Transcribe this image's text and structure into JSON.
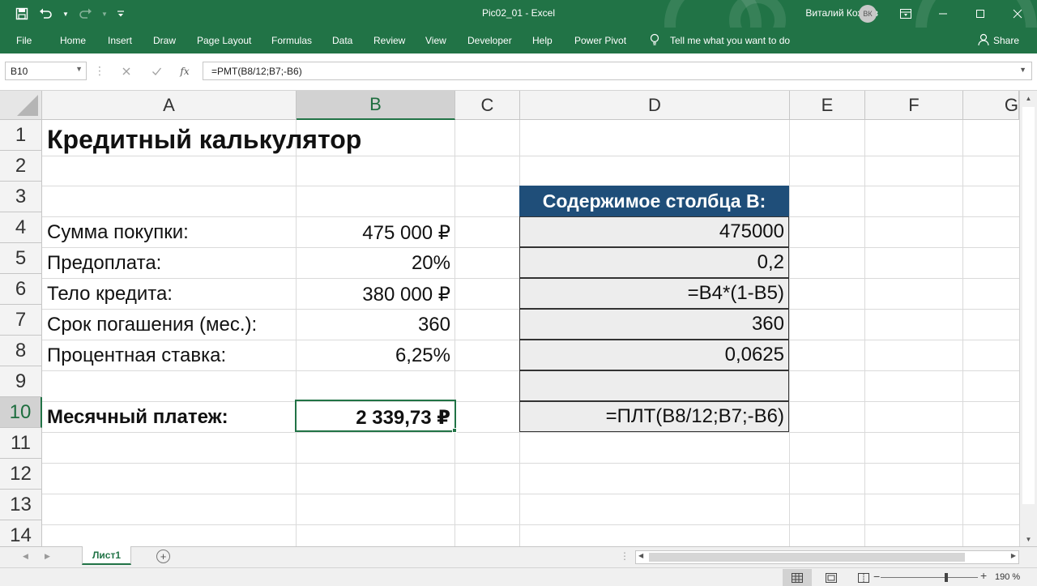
{
  "window": {
    "title": "Pic02_01  -  Excel",
    "user_name": "Виталий Козлов",
    "user_initials": "ВК"
  },
  "ribbon": {
    "tabs": [
      "File",
      "Home",
      "Insert",
      "Draw",
      "Page Layout",
      "Formulas",
      "Data",
      "Review",
      "View",
      "Developer",
      "Help",
      "Power Pivot"
    ],
    "tell_me": "Tell me what you want to do",
    "share": "Share"
  },
  "formula_bar": {
    "name_box": "B10",
    "fx": "fx",
    "formula": "=PMT(B8/12;B7;-B6)"
  },
  "grid": {
    "columns": [
      "A",
      "B",
      "C",
      "D",
      "E",
      "F",
      "G"
    ],
    "selected_column": "B",
    "rows": [
      "1",
      "2",
      "3",
      "4",
      "5",
      "6",
      "7",
      "8",
      "9",
      "10",
      "11",
      "12",
      "13",
      "14"
    ],
    "selected_row": "10",
    "title": "Кредитный калькулятор",
    "labels": {
      "r4": "Сумма покупки:",
      "r5": "Предоплата:",
      "r6": "Тело кредита:",
      "r7": "Срок погашения (мес.):",
      "r8": "Процентная ставка:",
      "r10": "Месячный платеж:"
    },
    "values": {
      "r4": "475 000 ₽",
      "r5": "20%",
      "r6": "380 000 ₽",
      "r7": "360",
      "r8": "6,25%",
      "r10": "2 339,73 ₽"
    },
    "d_header": "Содержимое столбца B:",
    "d_values": {
      "r4": "475000",
      "r5": "0,2",
      "r6": "=B4*(1-B5)",
      "r7": "360",
      "r8": "0,0625",
      "r9": "",
      "r10": "=ПЛТ(B8/12;B7;-B6)"
    }
  },
  "sheets": {
    "active": "Лист1"
  },
  "status": {
    "zoom": "190 %"
  }
}
